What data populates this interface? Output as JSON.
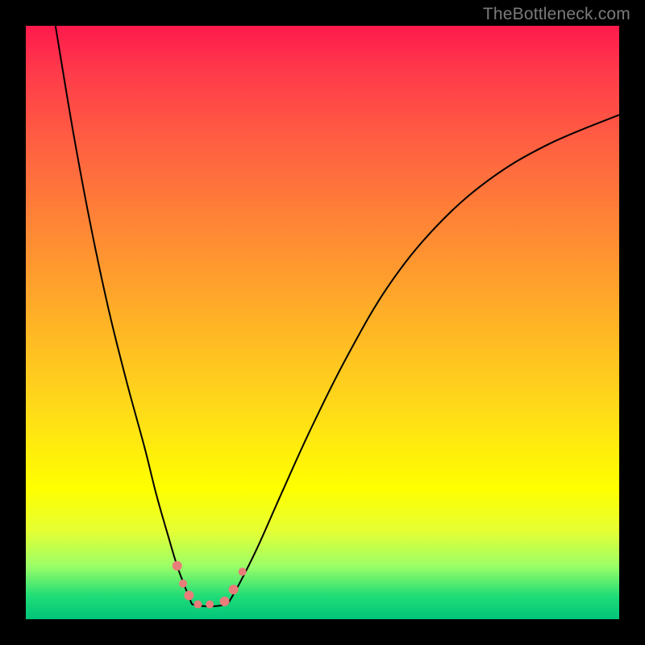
{
  "watermark": "TheBottleneck.com",
  "chart_data": {
    "type": "line",
    "title": "",
    "xlabel": "",
    "ylabel": "",
    "xlim": [
      0,
      100
    ],
    "ylim": [
      0,
      100
    ],
    "series": [
      {
        "name": "left-branch",
        "x": [
          5,
          8,
          11,
          14,
          17,
          20,
          22,
          24,
          25.5,
          27,
          28
        ],
        "values": [
          100,
          82,
          66,
          52,
          40,
          29,
          21,
          14,
          9,
          5,
          2.5
        ]
      },
      {
        "name": "right-branch",
        "x": [
          34,
          36,
          39,
          43,
          48,
          54,
          61,
          69,
          78,
          88,
          100
        ],
        "values": [
          2.5,
          6,
          12,
          21,
          32,
          44,
          56,
          66,
          74,
          80,
          85
        ]
      },
      {
        "name": "floor",
        "x": [
          28,
          30,
          32,
          34
        ],
        "values": [
          2.5,
          2.2,
          2.2,
          2.5
        ]
      }
    ],
    "markers": {
      "name": "highlighted-points",
      "x": [
        25.5,
        26.5,
        27.5,
        29,
        31,
        33.5,
        35,
        36.5
      ],
      "values": [
        9,
        6,
        4,
        2.5,
        2.5,
        3,
        5,
        8
      ],
      "r": [
        6,
        5,
        6,
        5,
        5,
        6,
        6,
        5
      ]
    }
  }
}
